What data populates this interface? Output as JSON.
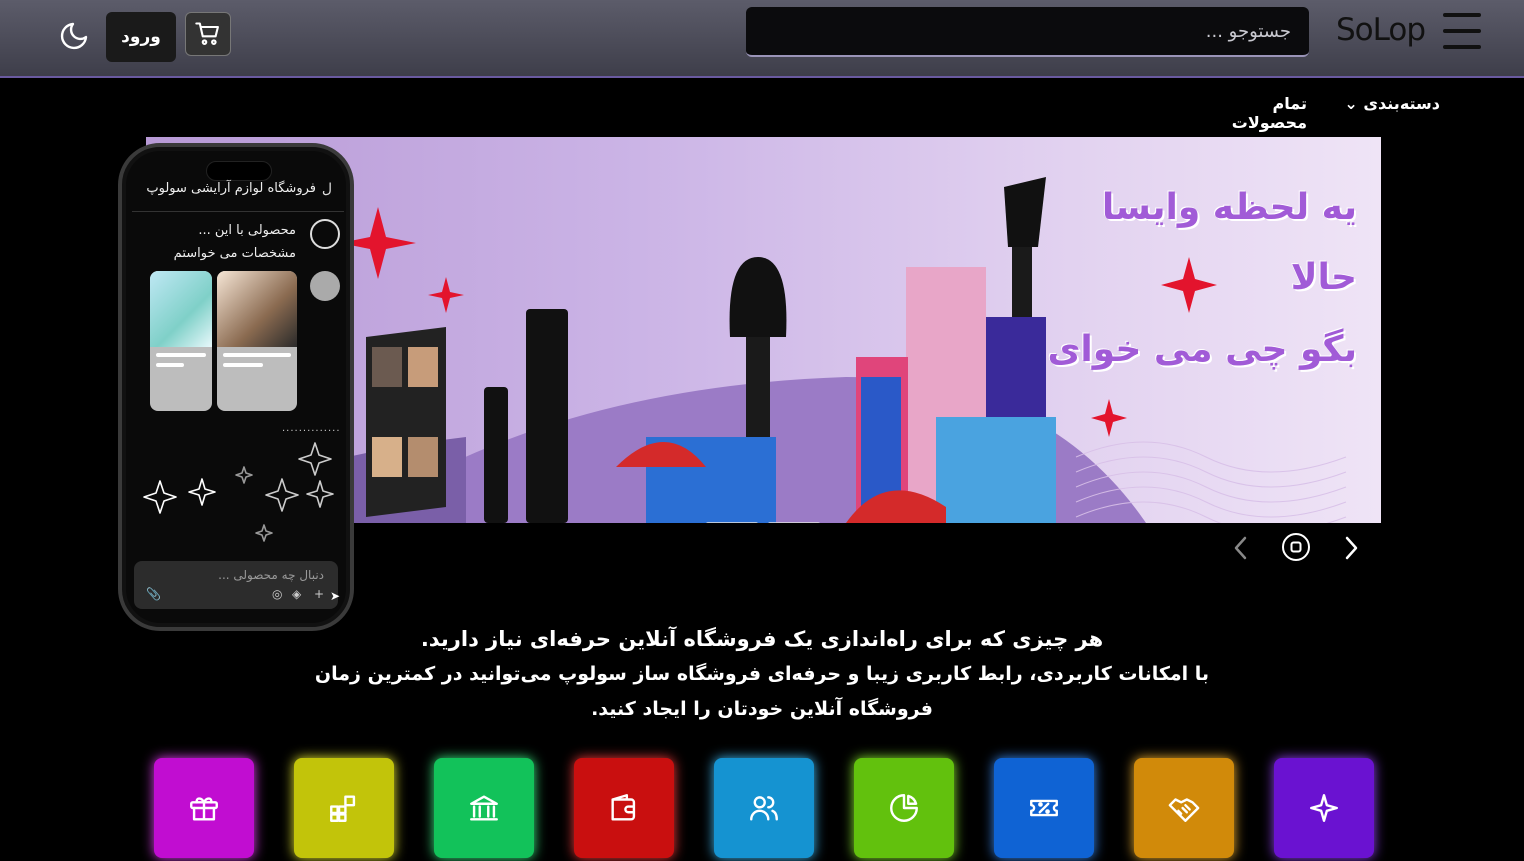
{
  "header": {
    "logo": "SoLop",
    "search_placeholder": "جستوجو ...",
    "login_label": "ورود"
  },
  "nav": {
    "categories_label": "دسته‌بندی ⌄",
    "all_products_label": "تمام محصولات"
  },
  "banner": {
    "line1": "یه لحظه وایسا",
    "line2": "حالا",
    "line3": "بگو چی می خوای"
  },
  "phone": {
    "title": "فروشگاه لوازم آرایشی سولوپ",
    "title_icon": "ل",
    "message": "محصولی با این ... مشخصات می خواستم",
    "dots": "...............",
    "input_placeholder": "دنبال چه محصولی ..."
  },
  "description": {
    "line1": "هر چیزی که برای راه‌اندازی یک فروشگاه آنلاین حرفه‌ای نیاز دارید.",
    "line2": "با امکانات کاربردی، رابط کاربری زیبا و حرفه‌ای فروشگاه ساز سولوپ می‌توانید در کمترین زمان",
    "line3": "فروشگاه آنلاین خودتان را ایجاد کنید."
  },
  "colors": {
    "tile_gift": "#c10dd1",
    "tile_apps": "#c2c40a",
    "tile_bank": "#12c25a",
    "tile_wallet": "#c90f0f",
    "tile_users": "#1593d1",
    "tile_chart": "#62c10d",
    "tile_discount": "#0f63d4",
    "tile_handshake": "#d18a0a",
    "tile_sparkle": "#6a12d1"
  },
  "icons": [
    "menu-icon",
    "cart-icon",
    "moon-icon",
    "chevron-left-icon",
    "pause-icon",
    "chevron-right-icon",
    "gift-icon",
    "apps-icon",
    "bank-icon",
    "wallet-icon",
    "users-icon",
    "pie-chart-icon",
    "discount-icon",
    "handshake-icon",
    "sparkle-icon"
  ]
}
